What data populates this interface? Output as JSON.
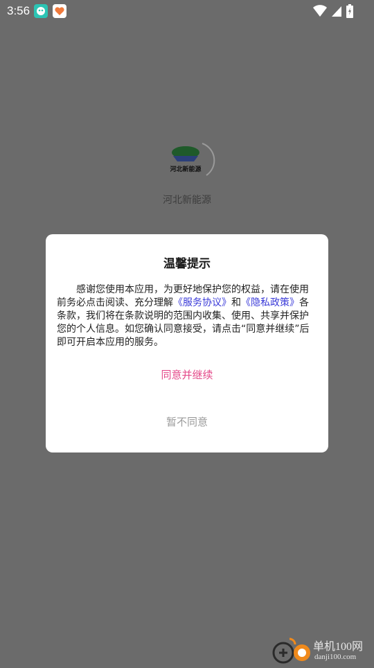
{
  "status_bar": {
    "time": "3:56"
  },
  "splash": {
    "app_name": "河北新能源",
    "logo_text": "河北新能源"
  },
  "dialog": {
    "title": "温馨提示",
    "body_part1": "感谢您使用本应用，为更好地保护您的权益，请在使用前务必点击阅读、充分理解",
    "service_link": "《服务协议》",
    "body_part2": "和",
    "privacy_link": "《隐私政策》",
    "body_part3": "各条款，我们将在条款说明的范围内收集、使用、共享并保护您的个人信息。如您确认同意接受，请点击“同意并继续”后即可开启本应用的服务。",
    "agree_label": "同意并继续",
    "decline_label": "暂不同意"
  },
  "watermark": {
    "text": "单机100网",
    "url": "danji100.com"
  },
  "colors": {
    "overlay": "#6b6b6b",
    "agree": "#e44a8a",
    "decline": "#9a9a9a",
    "link": "#3a3ad8"
  }
}
